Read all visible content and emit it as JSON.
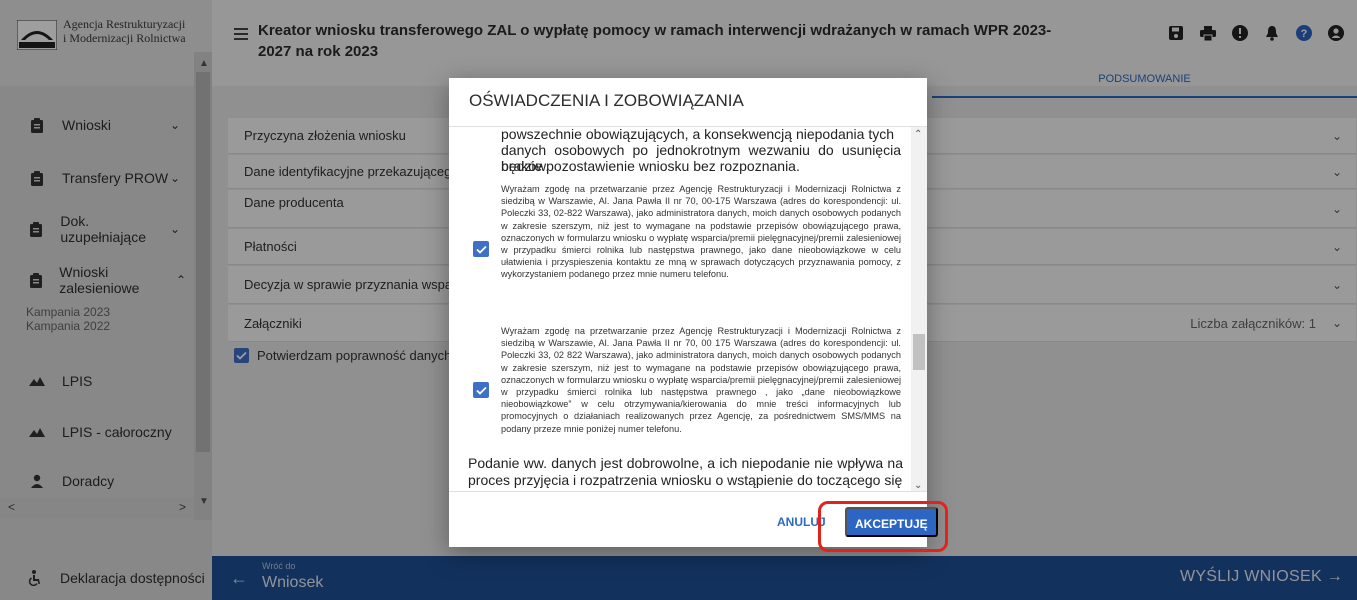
{
  "logo": {
    "line1": "Agencja Restrukturyzacji",
    "line2": "i Modernizacji Rolnictwa",
    "mark_text": "ARiMR"
  },
  "sidebar": {
    "items": [
      {
        "label": "Wnioski",
        "icon": "clipboard-icon",
        "chevron": "chevron-down"
      },
      {
        "label": "Transfery PROW",
        "icon": "clipboard-icon",
        "chevron": "chevron-down"
      },
      {
        "label": "Dok. uzupełniające",
        "icon": "clipboard-icon",
        "chevron": "chevron-down"
      },
      {
        "label": "Wnioski zalesieniowe",
        "icon": "clipboard-icon",
        "chevron": "chevron-up"
      },
      {
        "label": "LPIS",
        "icon": "mountains-icon"
      },
      {
        "label": "LPIS - całoroczny",
        "icon": "mountains-icon"
      },
      {
        "label": "Doradcy",
        "icon": "person-icon"
      }
    ],
    "sub_items": [
      "Kampania 2023",
      "Kampania 2022"
    ],
    "footer": "Deklaracja dostępności"
  },
  "header": {
    "title": "Kreator wniosku transferowego ZAL o wypłatę pomocy w ramach interwencji wdrażanych w ramach WPR 2023-2027 na rok 2023",
    "active_tab": "PODSUMOWANIE",
    "tools": [
      "save-icon",
      "print-icon",
      "alert-icon",
      "bell-icon",
      "help-icon",
      "user-icon"
    ]
  },
  "sections": [
    {
      "label": "Przyczyna złożenia wniosku"
    },
    {
      "label": "Dane identyfikacyjne przekazującego a"
    },
    {
      "label": "Dane producenta"
    },
    {
      "label": "Płatności"
    },
    {
      "label": "Decyzja w sprawie przyznania wsparcia"
    },
    {
      "label": "Załączniki",
      "extra": "Liczba załączników: 1"
    }
  ],
  "confirm_label": "Potwierdzam poprawność danych",
  "dialog": {
    "title": "OŚWIADCZENIA I ZOBOWIĄZANIA",
    "top_text_1": "powszechnie obowiązujących, a konsekwencją niepodania tych",
    "top_text_2": "danych osobowych po jednokrotnym wezwaniu do usunięcia braków,",
    "top_text_3": "będzie pozostawienie wniosku bez rozpoznania.",
    "consent_1": "Wyrażam zgodę na przetwarzanie przez Agencję Restrukturyzacji i Modernizacji Rolnictwa z siedzibą w Warszawie, Al. Jana Pawła II nr 70, 00-175 Warszawa (adres do korespondencji: ul. Poleczki 33, 02-822 Warszawa), jako administratora danych, moich danych osobowych podanych w zakresie szerszym, niż jest to wymagane na podstawie przepisów obowiązującego prawa, oznaczonych w formularzu wniosku o wypłatę wsparcia/premii pielęgnacyjnej/premii zalesieniowej w przypadku śmierci rolnika lub następstwa prawnego, jako dane nieobowiązkowe w celu ułatwienia i przyspieszenia kontaktu ze mną w sprawach dotyczących przyznawania pomocy, z wykorzystaniem podanego przez mnie numeru telefonu.",
    "consent_2": "Wyrażam zgodę na przetwarzanie przez Agencję Restrukturyzacji i Modernizacji Rolnictwa z siedzibą w Warszawie, Al. Jana Pawła II nr 70, 00 175 Warszawa (adres do korespondencji: ul. Poleczki 33, 02 822 Warszawa), jako administratora danych, moich danych osobowych podanych w zakresie szerszym, niż jest to wymagane na podstawie przepisów obowiązującego prawa, oznaczonych w formularzu wniosku o wypłatę wsparcia/premii pielęgnacyjnej/premii zalesieniowej w przypadku śmierci rolnika lub następstwa prawnego , jako „dane nieobowiązkowe nieobowiązkowe” w celu otrzymywania/kierowania do mnie treści informacyjnych lub promocyjnych o działaniach realizowanych przez Agencję, za pośrednictwem SMS/MMS na podany przeze mnie poniżej numer telefonu.",
    "bottom_text": "Podanie ww. danych jest dobrowolne, a ich niepodanie nie wpływa na proces przyjęcia i rozpatrzenia wniosku o wstąpienie do toczącego się",
    "cancel_label": "ANULUJ",
    "accept_label": "AKCEPTUJĘ"
  },
  "bottom_bar": {
    "back_small": "Wróć do",
    "back_main": "Wniosek",
    "send_label": "WYŚLIJ WNIOSEK"
  },
  "colors": {
    "accent": "#2d65c2",
    "bottom_bar": "#1f4f96",
    "highlight": "#e3231b"
  }
}
